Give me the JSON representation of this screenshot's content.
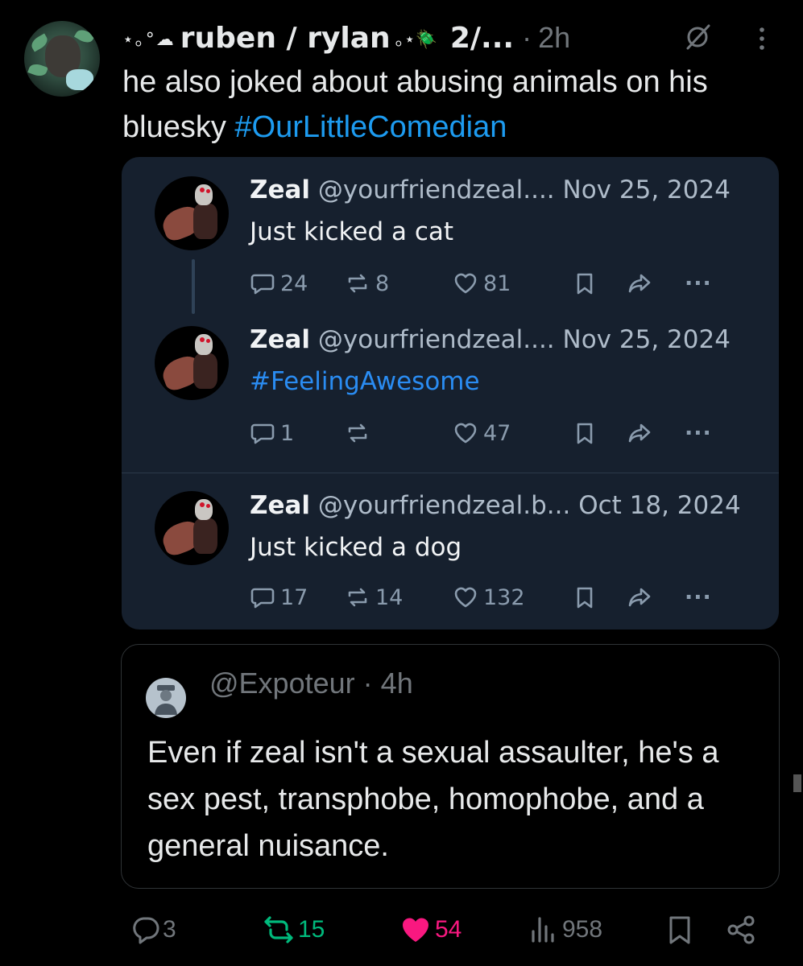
{
  "post": {
    "deco_before": "⋆｡°☁︎",
    "display_name": "ruben / rylan",
    "deco_after": "｡⋆🪲",
    "name_suffix": "2/...",
    "separator": "·",
    "time": "2h",
    "text": "he also joked about abusing animals on his bluesky ",
    "hashtag": "#OurLittleComedian"
  },
  "embed": {
    "posts": [
      {
        "name": "Zeal",
        "handle": "@yourfriendzeal....",
        "date": "Nov 25, 2024",
        "text": "Just kicked a cat",
        "is_tag": false,
        "replies": "24",
        "reposts": "8",
        "likes": "81"
      },
      {
        "name": "Zeal",
        "handle": "@yourfriendzeal....",
        "date": "Nov 25, 2024",
        "text": "#FeelingAwesome",
        "is_tag": true,
        "replies": "1",
        "reposts": "",
        "likes": "47"
      },
      {
        "name": "Zeal",
        "handle": "@yourfriendzeal.b...",
        "date": "Oct 18, 2024",
        "text": "Just kicked a dog",
        "is_tag": false,
        "replies": "17",
        "reposts": "14",
        "likes": "132"
      }
    ],
    "more_label": "···"
  },
  "quote": {
    "handle": "@Expoteur",
    "separator": "·",
    "time": "4h",
    "text": "Even if zeal isn't a sexual assaulter, he's a sex pest, transphobe, homophobe, and a general nuisance."
  },
  "actions": {
    "replies": "3",
    "reposts": "15",
    "likes": "54",
    "views": "958"
  },
  "colors": {
    "background": "#000000",
    "link": "#1d9bf0",
    "repost": "#00ba7c",
    "like": "#f91880",
    "muted": "#71767b",
    "embed_bg": "#16202e"
  },
  "icons": [
    "grok-icon",
    "more-vertical-icon",
    "reply-icon",
    "repost-icon",
    "like-icon",
    "bookmark-icon",
    "share-icon",
    "more-horizontal-icon",
    "views-icon"
  ]
}
